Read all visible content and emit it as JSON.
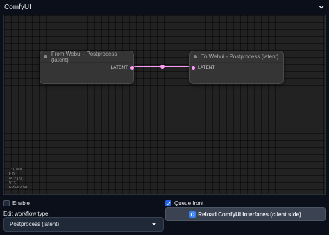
{
  "header": {
    "title": "ComfyUI",
    "collapse_icon": "chevron-down-icon"
  },
  "nodes": [
    {
      "title": "From Webui - Postprocess (latent)",
      "output_label": "LATENT"
    },
    {
      "title": "To Webui - Postprocess (latent)",
      "input_label": "LATENT"
    }
  ],
  "link": {
    "color": "#ff9cf9"
  },
  "stats": {
    "t": "T: 0.00s",
    "i": "I: 0",
    "n": "N: 2 [2]",
    "v": "V: 3",
    "fps": "FPS:62.50"
  },
  "controls": {
    "enable": {
      "label": "Enable",
      "checked": false
    },
    "queue_front": {
      "label": "Queue front",
      "checked": true
    },
    "workflow_type": {
      "label": "Edit workflow type",
      "value": "Postprocess (latent)"
    },
    "reload_button": {
      "label": "Reload ComfyUI interfaces (client side)",
      "icon": "reload-icon"
    }
  },
  "colors": {
    "accent": "#2563eb",
    "background": "#0b0f19",
    "canvas": "#222222"
  }
}
